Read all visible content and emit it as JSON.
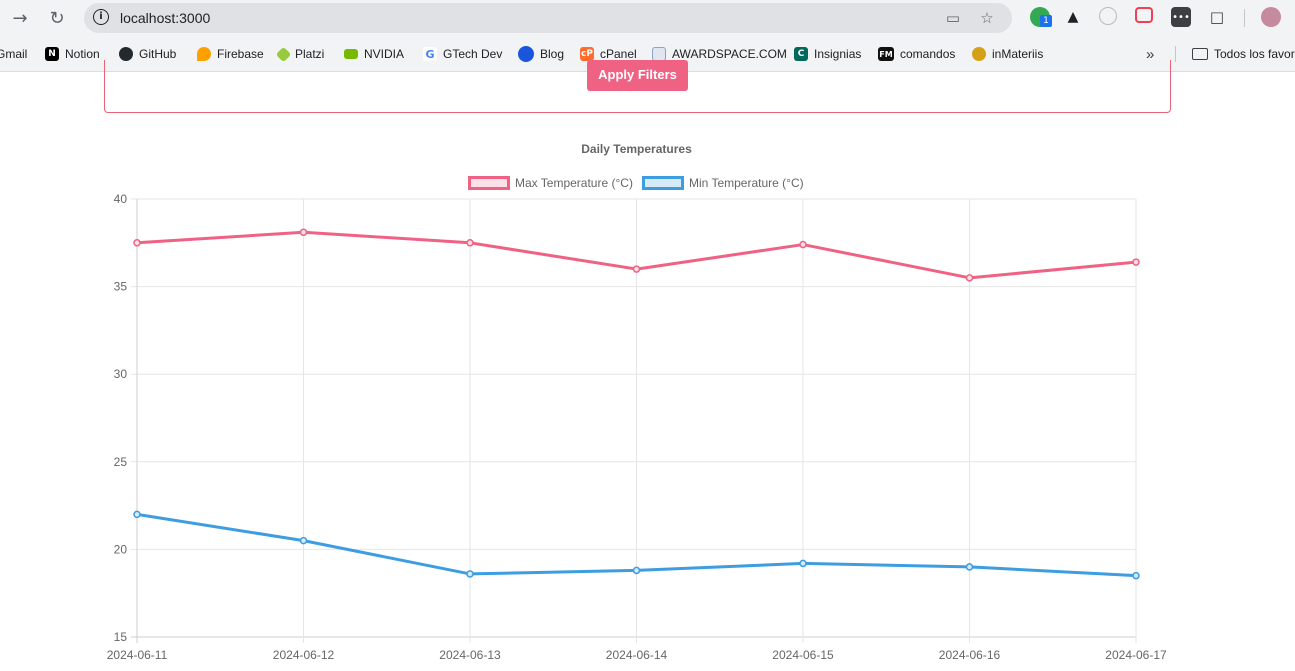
{
  "browser": {
    "url": "localhost:3000",
    "extension_badge": "1",
    "bookmarks": [
      {
        "label": "Gmail",
        "icon": "gmail-icon",
        "color": "#ea4335"
      },
      {
        "label": "Notion",
        "icon": "notion-icon",
        "color": "#000000"
      },
      {
        "label": "GitHub",
        "icon": "github-icon",
        "color": "#24292f"
      },
      {
        "label": "Firebase",
        "icon": "firebase-icon",
        "color": "#ffa000"
      },
      {
        "label": "Platzi",
        "icon": "platzi-icon",
        "color": "#98ca3f"
      },
      {
        "label": "NVIDIA",
        "icon": "nvidia-icon",
        "color": "#76b900"
      },
      {
        "label": "GTech Dev",
        "icon": "google-icon",
        "color": "#4285f4"
      },
      {
        "label": "Blog",
        "icon": "blog-icon",
        "color": "#1a56db"
      },
      {
        "label": "cPanel",
        "icon": "cpanel-icon",
        "color": "#ff6c2c"
      },
      {
        "label": "AWARDSPACE.COM",
        "icon": "awardspace-icon",
        "color": "#8aa4c8"
      },
      {
        "label": "Insignias",
        "icon": "insignias-icon",
        "color": "#00695c"
      },
      {
        "label": "comandos",
        "icon": "fm-icon",
        "color": "#111111"
      },
      {
        "label": "inMateriis",
        "icon": "inmateriis-icon",
        "color": "#d4a017"
      }
    ],
    "more": "»",
    "folder": "Todos los favor"
  },
  "page": {
    "apply_button": "Apply Filters",
    "accent": "#f06284"
  },
  "chart_data": {
    "type": "line",
    "title": "Daily Temperatures",
    "categories": [
      "2024-06-11",
      "2024-06-12",
      "2024-06-13",
      "2024-06-14",
      "2024-06-15",
      "2024-06-16",
      "2024-06-17"
    ],
    "series": [
      {
        "name": "Max Temperature (°C)",
        "color": "#f06284",
        "fill": "#fce0e7",
        "values": [
          37.5,
          38.1,
          37.5,
          36.0,
          37.4,
          35.5,
          36.4
        ]
      },
      {
        "name": "Min Temperature (°C)",
        "color": "#3d9de0",
        "fill": "#d6eaf8",
        "values": [
          22.0,
          20.5,
          18.6,
          18.8,
          19.2,
          19.0,
          18.5
        ]
      }
    ],
    "ylim": [
      15,
      40
    ],
    "yticks": [
      15,
      20,
      25,
      30,
      35,
      40
    ],
    "grid": true,
    "legend": "top"
  }
}
